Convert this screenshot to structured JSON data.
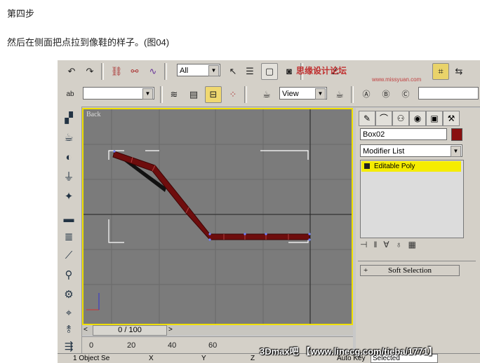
{
  "article": {
    "step_title": "第四步",
    "text": "然后在侧面把点拉到像鞋的样子。(图04)"
  },
  "toolbar": {
    "selection_filter": "All",
    "ref_coord": "View"
  },
  "viewport": {
    "label": "Back"
  },
  "command_panel": {
    "object_name": "Box02",
    "modifier_list": "Modifier List",
    "stack_item": "Editable Poly",
    "rollout_soft_selection": "Soft Selection",
    "rollout_plus": "+"
  },
  "time_slider": {
    "left_arrow": "<",
    "position": "0 / 100",
    "right_arrow": ">"
  },
  "track_bar": {
    "ticks": [
      "0",
      "20",
      "40",
      "60"
    ]
  },
  "status_bar": {
    "selection": "1 Object Se",
    "x_label": "X",
    "y_label": "Y",
    "z_label": "Z",
    "auto_key": "Auto Key",
    "selected": "Selected"
  },
  "watermark": {
    "top": "思缘设计论坛",
    "top_sub": "www.missyuan.com",
    "bottom": "3Dmax吧 【www.linecg.com/tieba/1771】"
  },
  "colors": {
    "viewport_bg": "#7b7b7b",
    "active_border": "#f0e000",
    "shoe_poly": "#6e0d0d",
    "stack_highlight": "#f5ec00"
  }
}
